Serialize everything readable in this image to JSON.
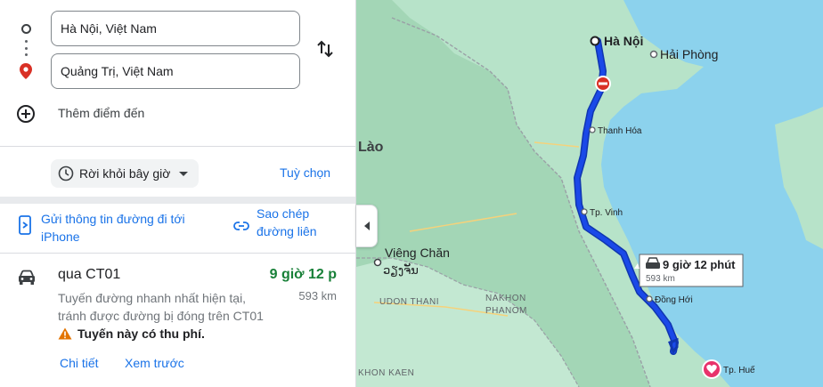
{
  "directions": {
    "origin": "Hà Nội, Việt Nam",
    "destination": "Quảng Trị, Việt Nam",
    "add_destination": "Thêm điểm đến",
    "depart_label": "Rời khỏi bây giờ",
    "options_label": "Tuỳ chọn",
    "send_to_phone": "Gửi thông tin đường đi tới iPhone",
    "copy_link": "Sao chép đường liên kết"
  },
  "route": {
    "via": "qua CT01",
    "time": "9 giờ 12 p",
    "distance": "593 km",
    "description": "Tuyến đường nhanh nhất hiện tại, tránh được đường bị đóng trên CT01",
    "toll_note": "Tuyến này có thu phí.",
    "details_label": "Chi tiết",
    "preview_label": "Xem trước"
  },
  "map": {
    "labels": {
      "ha_noi": "Hà Nội",
      "hai_phong": "Hải Phòng",
      "lao": "Lào",
      "thanh_hoa": "Thanh Hóa",
      "vinh": "Tp. Vinh",
      "vieng_chan": "Viêng Chăn",
      "vieng_chan_lao": "ວຽງຈັນ",
      "udon_thani": "UDON THANI",
      "nakhon_phanom_1": "NAKHON",
      "nakhon_phanom_2": "PHANOM",
      "khon_kaen": "KHON KAEN",
      "dong_hoi": "Đồng Hới",
      "hue": "Tp. Huế"
    },
    "callout": {
      "time": "9 giờ 12 phút",
      "distance": "593 km"
    },
    "colors": {
      "sea": "#8cd2ed",
      "land": "#b7e3c9",
      "land_dark": "#a3d6b6",
      "route": "#1a49e8",
      "route_outline": "#1036b0",
      "destination_pin": "#e8336b"
    }
  }
}
